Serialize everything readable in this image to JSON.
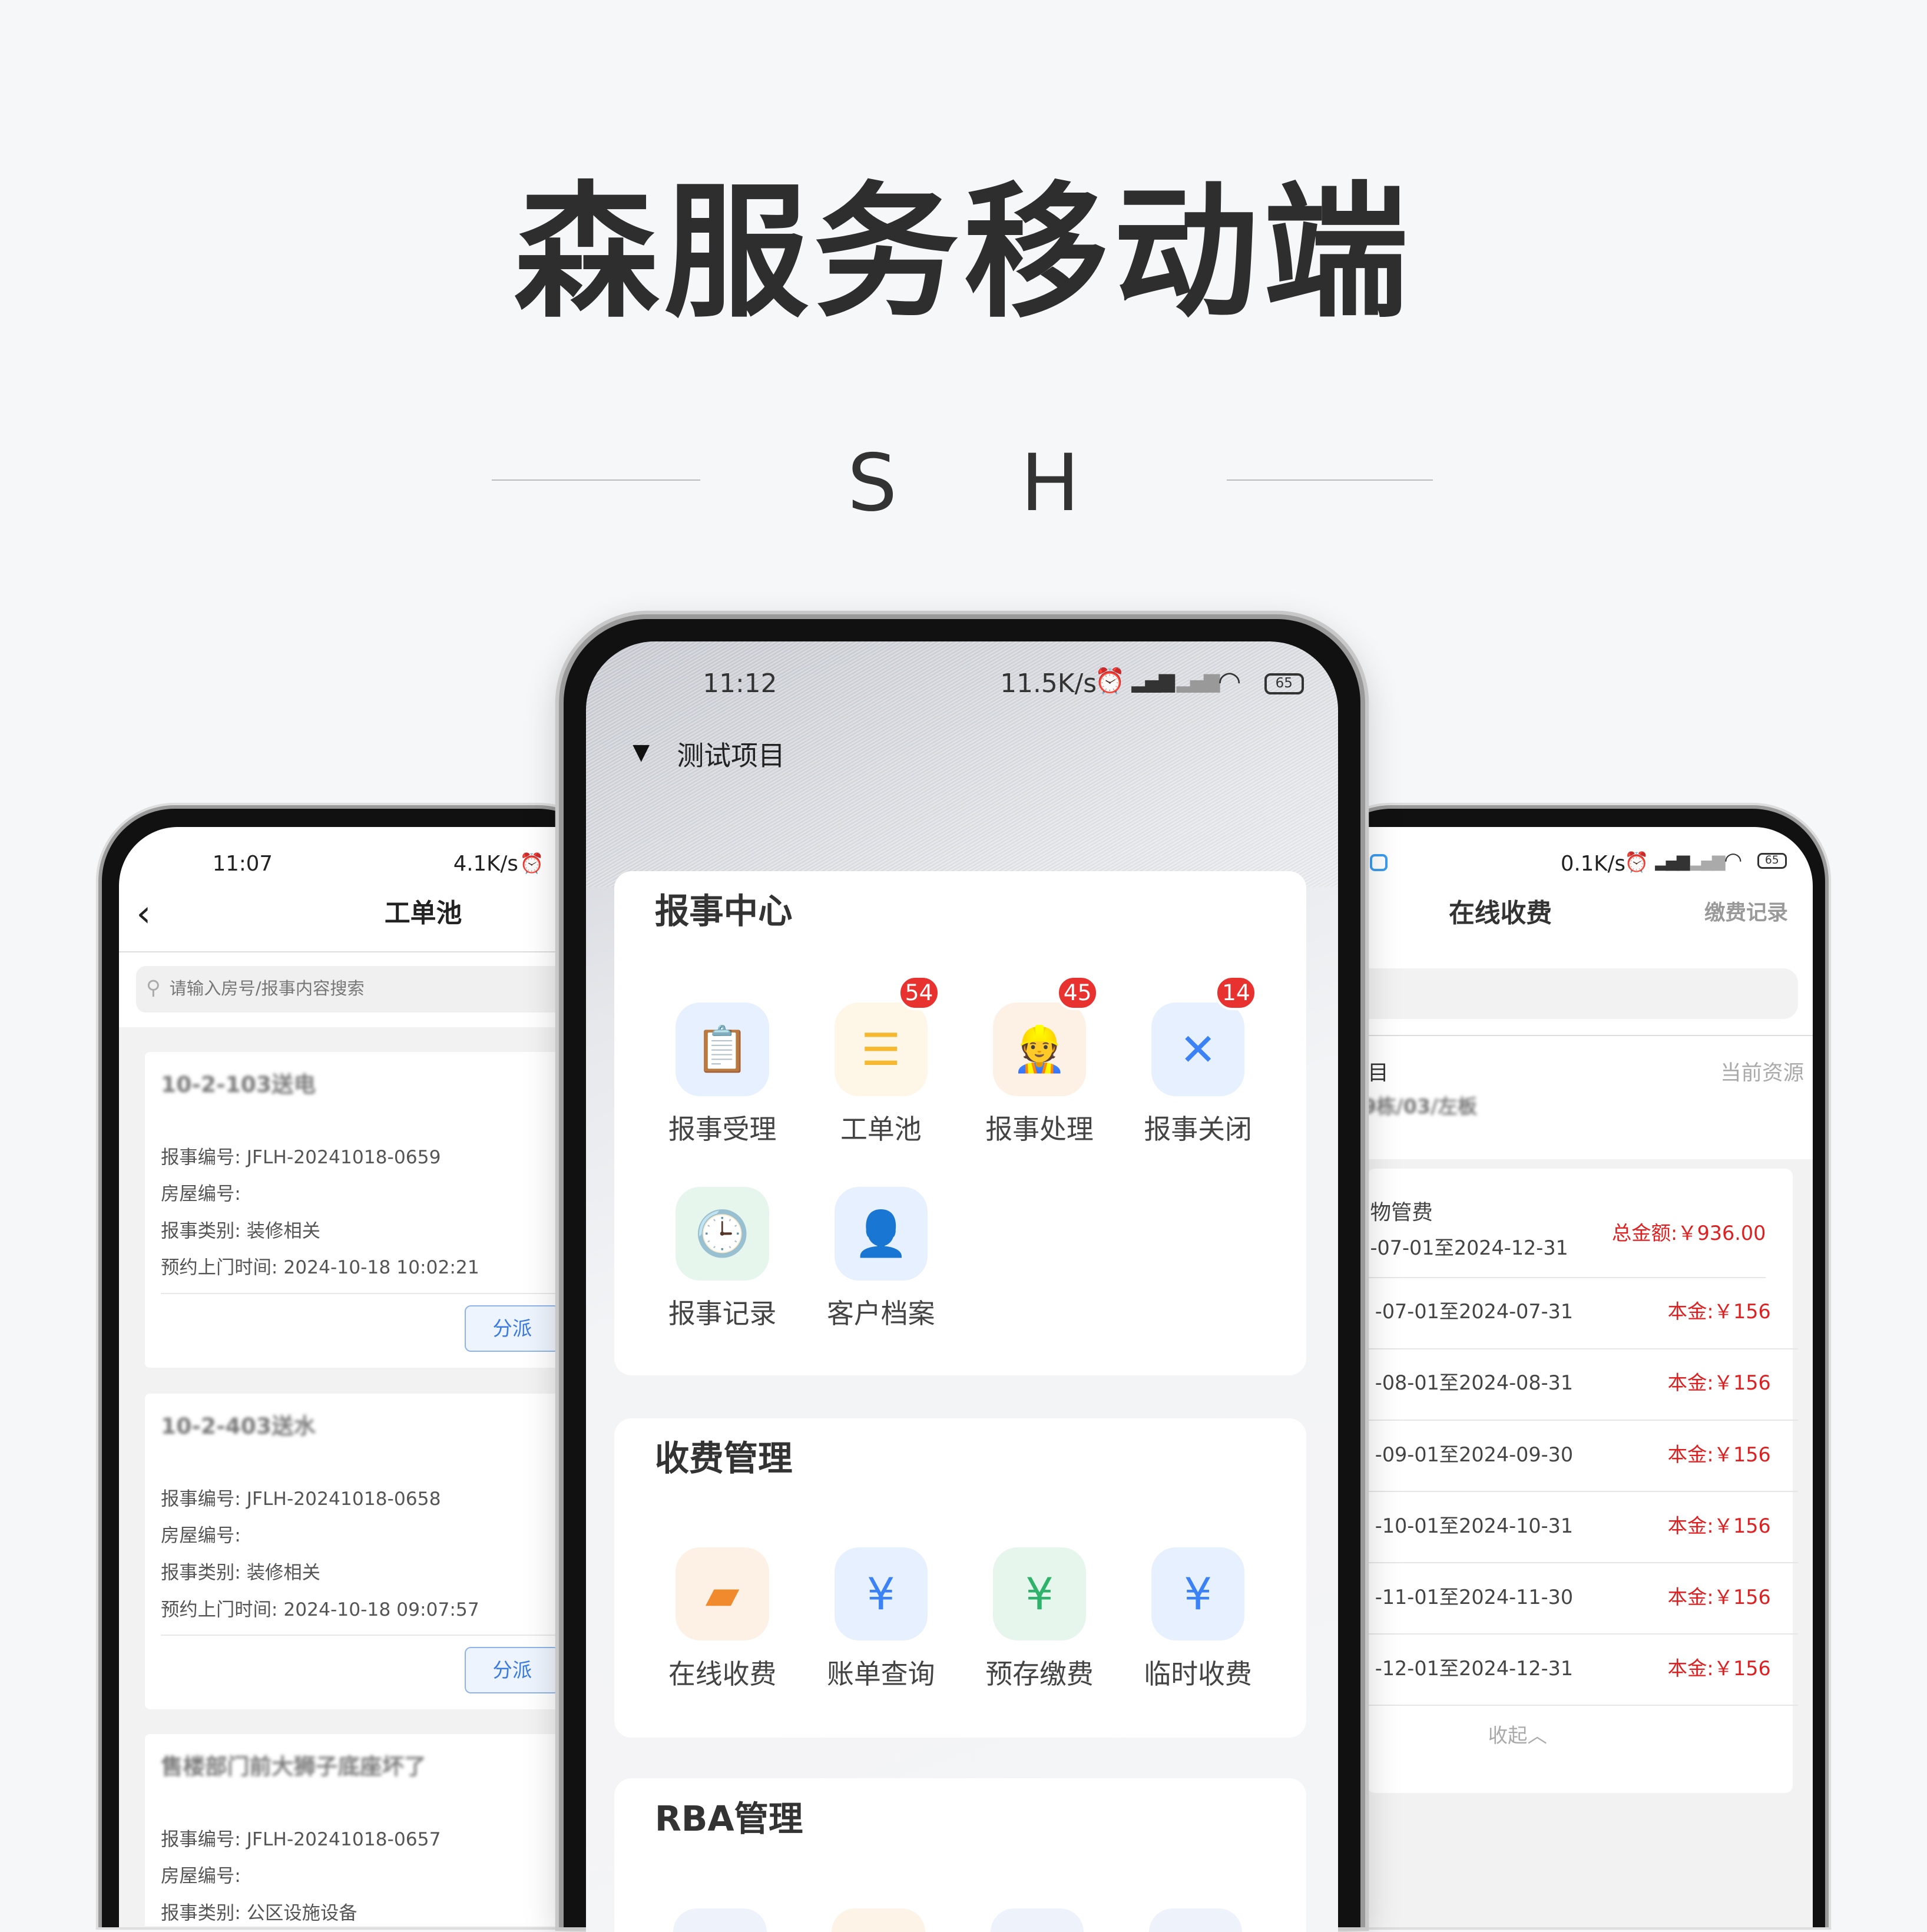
{
  "heading": "森服务移动端",
  "subheading": "S H",
  "left_phone": {
    "status": {
      "time": "11:07",
      "speed": "4.1K/s"
    },
    "title": "工单池",
    "search_placeholder": "请输入房号/报事内容搜索",
    "cards": [
      {
        "room": "10-2-103送电",
        "number": "报事编号: JFLH-20241018-0659",
        "house": "房屋编号:",
        "category": "报事类别: 装修相关",
        "time": "预约上门时间: 2024-10-18 10:02:21",
        "action": "分派"
      },
      {
        "room": "10-2-403送水",
        "number": "报事编号: JFLH-20241018-0658",
        "house": "房屋编号:",
        "category": "报事类别: 装修相关",
        "time": "预约上门时间: 2024-10-18 09:07:57",
        "action": "分派"
      },
      {
        "room": "售楼部门前大狮子底座坏了",
        "number": "报事编号: JFLH-20241018-0657",
        "house": "房屋编号:",
        "category": "报事类别: 公区设施设备"
      }
    ]
  },
  "center_phone": {
    "status": {
      "time": "11:12",
      "speed": "11.5K/s",
      "battery": "65"
    },
    "project": "测试项目",
    "sections": [
      {
        "title": "报事中心",
        "items": [
          {
            "label": "报事受理",
            "icon": "clipboard-edit-icon",
            "color": "#3b82f6"
          },
          {
            "label": "工单池",
            "icon": "document-list-icon",
            "badge": "54",
            "color": "#f5b82e"
          },
          {
            "label": "报事处理",
            "icon": "worker-repair-icon",
            "badge": "45",
            "color": "#f08a2c"
          },
          {
            "label": "报事关闭",
            "icon": "clipboard-close-icon",
            "badge": "14",
            "color": "#3b82f6"
          },
          {
            "label": "报事记录",
            "icon": "clipboard-clock-icon",
            "color": "#2fb36b"
          },
          {
            "label": "客户档案",
            "icon": "user-search-icon",
            "color": "#3b82f6"
          }
        ]
      },
      {
        "title": "收费管理",
        "items": [
          {
            "label": "在线收费",
            "icon": "wallet-icon",
            "color": "#f08a2c"
          },
          {
            "label": "账单查询",
            "icon": "money-bag-icon",
            "color": "#3b82f6"
          },
          {
            "label": "预存缴费",
            "icon": "cash-icon",
            "color": "#2fb36b"
          },
          {
            "label": "临时收费",
            "icon": "hand-coin-icon",
            "color": "#3b82f6"
          }
        ]
      },
      {
        "title": "RBA管理"
      }
    ]
  },
  "right_phone": {
    "status": {
      "speed": "0.1K/s",
      "battery": "65"
    },
    "title": "在线收费",
    "record_link": "缴费记录",
    "project_label": "目",
    "resource_label": "当前资源",
    "resource_value": "9栋/03/左板",
    "fee_name": "物管费",
    "fee_range": "-07-01至2024-12-31",
    "total": "总金额:￥936.00",
    "rows": [
      {
        "range": "-07-01至2024-07-31",
        "amount": "本金:￥156"
      },
      {
        "range": "-08-01至2024-08-31",
        "amount": "本金:￥156"
      },
      {
        "range": "-09-01至2024-09-30",
        "amount": "本金:￥156"
      },
      {
        "range": "-10-01至2024-10-31",
        "amount": "本金:￥156"
      },
      {
        "range": "-11-01至2024-11-30",
        "amount": "本金:￥156"
      },
      {
        "range": "-12-01至2024-12-31",
        "amount": "本金:￥156"
      }
    ],
    "collapse": "收起︿"
  },
  "colors": {
    "accent": "#3a7be0",
    "badge": "#e8322f",
    "amount": "#e02020"
  }
}
